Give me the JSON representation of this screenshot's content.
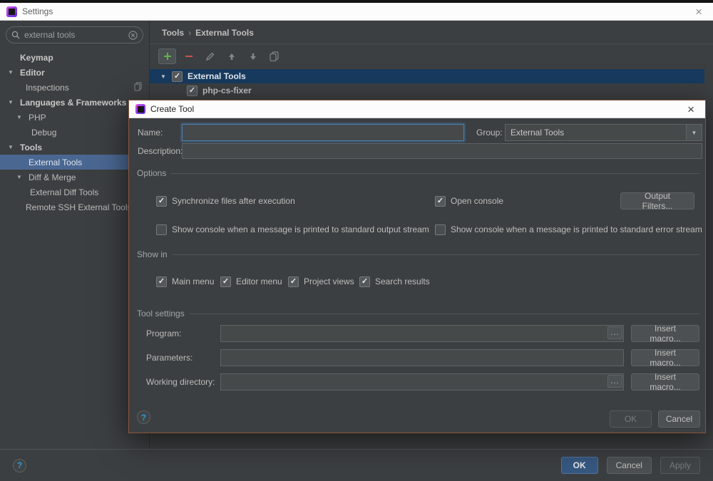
{
  "window": {
    "title": "Settings"
  },
  "glyphs": {
    "close": "×",
    "arrow_down": "▼",
    "check": "✓",
    "breadcrumb_sep": "›"
  },
  "icons": {
    "app": "phpstorm-logo",
    "search": "magnifier",
    "clear": "circle-x",
    "add": "green-plus",
    "remove": "red-minus",
    "edit": "pencil",
    "move_up": "arrow-up",
    "move_down": "arrow-down",
    "copy": "duplicate",
    "help": "question-mark"
  },
  "search": {
    "value": "external tools"
  },
  "sidebar": {
    "items": [
      {
        "label": "Keymap"
      },
      {
        "label": "Editor"
      },
      {
        "label": "Inspections"
      },
      {
        "label": "Languages & Frameworks"
      },
      {
        "label": "PHP"
      },
      {
        "label": "Debug"
      },
      {
        "label": "Tools"
      },
      {
        "label": "External Tools"
      },
      {
        "label": "Diff & Merge"
      },
      {
        "label": "External Diff Tools"
      },
      {
        "label": "Remote SSH External Tools"
      }
    ]
  },
  "breadcrumb": {
    "section": "Tools",
    "page": "External Tools"
  },
  "tree": {
    "rows": [
      {
        "label": "External Tools",
        "checked": true,
        "selected": true
      },
      {
        "label": "php-cs-fixer",
        "checked": true,
        "selected": false
      }
    ]
  },
  "dialog": {
    "title": "Create Tool",
    "name_label": "Name:",
    "name_value": "",
    "group_label": "Group:",
    "group_value": "External Tools",
    "description_label": "Description:",
    "description_value": "",
    "section_options": "Options",
    "opt_sync": "Synchronize files after execution",
    "opt_open_console": "Open console",
    "output_filters_button": "Output Filters...",
    "opt_stdout": "Show console when a message is printed to standard output stream",
    "opt_stderr": "Show console when a message is printed to standard error stream",
    "section_show_in": "Show in",
    "show_in": [
      {
        "label": "Main menu"
      },
      {
        "label": "Editor menu"
      },
      {
        "label": "Project views"
      },
      {
        "label": "Search results"
      }
    ],
    "section_tool_settings": "Tool settings",
    "program_label": "Program:",
    "program_value": "",
    "parameters_label": "Parameters:",
    "parameters_value": "",
    "working_dir_label": "Working directory:",
    "working_dir_value": "",
    "browse_button": "...",
    "insert_macro_button": "Insert macro...",
    "help": "?",
    "ok": "OK",
    "cancel": "Cancel"
  },
  "footer": {
    "help": "?",
    "ok": "OK",
    "cancel": "Cancel",
    "apply": "Apply"
  },
  "colors": {
    "window_bg": "#3c3f41",
    "titlebar_bg": "#fcfcfc",
    "sidebar_selection": "#4a6791",
    "tree_selection": "#173a5e",
    "dialog_border": "#8a563c",
    "primary_button": "#365880",
    "focus_border": "#4e7fb0",
    "add_icon_green": "#5db54a",
    "remove_icon_red": "#c75450",
    "help_blue": "#3897d3"
  }
}
